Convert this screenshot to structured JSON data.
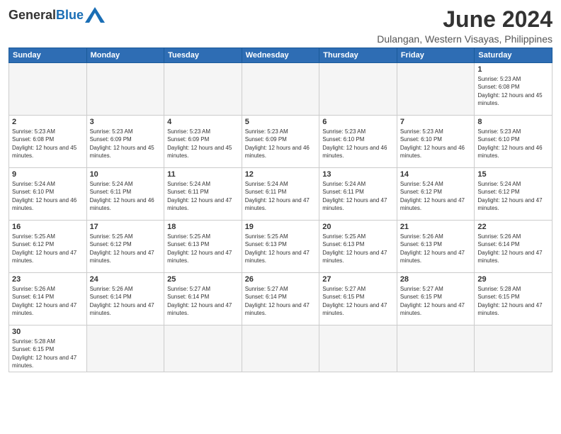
{
  "logo": {
    "general": "General",
    "blue": "Blue"
  },
  "title": {
    "month_year": "June 2024",
    "location": "Dulangan, Western Visayas, Philippines"
  },
  "weekdays": [
    "Sunday",
    "Monday",
    "Tuesday",
    "Wednesday",
    "Thursday",
    "Friday",
    "Saturday"
  ],
  "weeks": [
    [
      {
        "day": "",
        "info": ""
      },
      {
        "day": "",
        "info": ""
      },
      {
        "day": "",
        "info": ""
      },
      {
        "day": "",
        "info": ""
      },
      {
        "day": "",
        "info": ""
      },
      {
        "day": "",
        "info": ""
      },
      {
        "day": "1",
        "info": "Sunrise: 5:23 AM\nSunset: 6:08 PM\nDaylight: 12 hours and 45 minutes."
      }
    ],
    [
      {
        "day": "2",
        "info": "Sunrise: 5:23 AM\nSunset: 6:08 PM\nDaylight: 12 hours and 45 minutes."
      },
      {
        "day": "3",
        "info": "Sunrise: 5:23 AM\nSunset: 6:09 PM\nDaylight: 12 hours and 45 minutes."
      },
      {
        "day": "4",
        "info": "Sunrise: 5:23 AM\nSunset: 6:09 PM\nDaylight: 12 hours and 45 minutes."
      },
      {
        "day": "5",
        "info": "Sunrise: 5:23 AM\nSunset: 6:09 PM\nDaylight: 12 hours and 46 minutes."
      },
      {
        "day": "6",
        "info": "Sunrise: 5:23 AM\nSunset: 6:10 PM\nDaylight: 12 hours and 46 minutes."
      },
      {
        "day": "7",
        "info": "Sunrise: 5:23 AM\nSunset: 6:10 PM\nDaylight: 12 hours and 46 minutes."
      },
      {
        "day": "8",
        "info": "Sunrise: 5:23 AM\nSunset: 6:10 PM\nDaylight: 12 hours and 46 minutes."
      }
    ],
    [
      {
        "day": "9",
        "info": "Sunrise: 5:24 AM\nSunset: 6:10 PM\nDaylight: 12 hours and 46 minutes."
      },
      {
        "day": "10",
        "info": "Sunrise: 5:24 AM\nSunset: 6:11 PM\nDaylight: 12 hours and 46 minutes."
      },
      {
        "day": "11",
        "info": "Sunrise: 5:24 AM\nSunset: 6:11 PM\nDaylight: 12 hours and 47 minutes."
      },
      {
        "day": "12",
        "info": "Sunrise: 5:24 AM\nSunset: 6:11 PM\nDaylight: 12 hours and 47 minutes."
      },
      {
        "day": "13",
        "info": "Sunrise: 5:24 AM\nSunset: 6:11 PM\nDaylight: 12 hours and 47 minutes."
      },
      {
        "day": "14",
        "info": "Sunrise: 5:24 AM\nSunset: 6:12 PM\nDaylight: 12 hours and 47 minutes."
      },
      {
        "day": "15",
        "info": "Sunrise: 5:24 AM\nSunset: 6:12 PM\nDaylight: 12 hours and 47 minutes."
      }
    ],
    [
      {
        "day": "16",
        "info": "Sunrise: 5:25 AM\nSunset: 6:12 PM\nDaylight: 12 hours and 47 minutes."
      },
      {
        "day": "17",
        "info": "Sunrise: 5:25 AM\nSunset: 6:12 PM\nDaylight: 12 hours and 47 minutes."
      },
      {
        "day": "18",
        "info": "Sunrise: 5:25 AM\nSunset: 6:13 PM\nDaylight: 12 hours and 47 minutes."
      },
      {
        "day": "19",
        "info": "Sunrise: 5:25 AM\nSunset: 6:13 PM\nDaylight: 12 hours and 47 minutes."
      },
      {
        "day": "20",
        "info": "Sunrise: 5:25 AM\nSunset: 6:13 PM\nDaylight: 12 hours and 47 minutes."
      },
      {
        "day": "21",
        "info": "Sunrise: 5:26 AM\nSunset: 6:13 PM\nDaylight: 12 hours and 47 minutes."
      },
      {
        "day": "22",
        "info": "Sunrise: 5:26 AM\nSunset: 6:14 PM\nDaylight: 12 hours and 47 minutes."
      }
    ],
    [
      {
        "day": "23",
        "info": "Sunrise: 5:26 AM\nSunset: 6:14 PM\nDaylight: 12 hours and 47 minutes."
      },
      {
        "day": "24",
        "info": "Sunrise: 5:26 AM\nSunset: 6:14 PM\nDaylight: 12 hours and 47 minutes."
      },
      {
        "day": "25",
        "info": "Sunrise: 5:27 AM\nSunset: 6:14 PM\nDaylight: 12 hours and 47 minutes."
      },
      {
        "day": "26",
        "info": "Sunrise: 5:27 AM\nSunset: 6:14 PM\nDaylight: 12 hours and 47 minutes."
      },
      {
        "day": "27",
        "info": "Sunrise: 5:27 AM\nSunset: 6:15 PM\nDaylight: 12 hours and 47 minutes."
      },
      {
        "day": "28",
        "info": "Sunrise: 5:27 AM\nSunset: 6:15 PM\nDaylight: 12 hours and 47 minutes."
      },
      {
        "day": "29",
        "info": "Sunrise: 5:28 AM\nSunset: 6:15 PM\nDaylight: 12 hours and 47 minutes."
      }
    ],
    [
      {
        "day": "30",
        "info": "Sunrise: 5:28 AM\nSunset: 6:15 PM\nDaylight: 12 hours and 47 minutes."
      },
      {
        "day": "",
        "info": ""
      },
      {
        "day": "",
        "info": ""
      },
      {
        "day": "",
        "info": ""
      },
      {
        "day": "",
        "info": ""
      },
      {
        "day": "",
        "info": ""
      },
      {
        "day": "",
        "info": ""
      }
    ]
  ]
}
